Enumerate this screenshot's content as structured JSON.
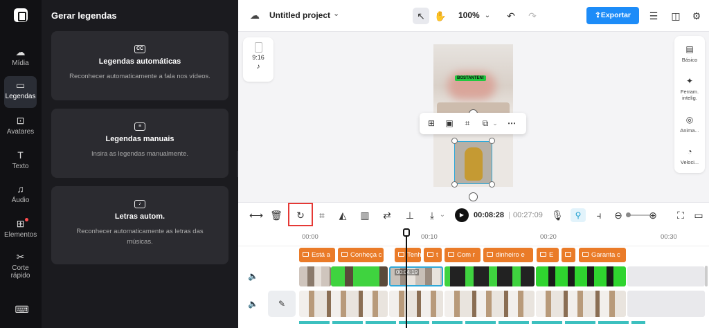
{
  "rail": {
    "items": [
      {
        "label": "Mídia",
        "icon": "cloud-upload-icon"
      },
      {
        "label": "Legendas",
        "icon": "captions-icon",
        "active": true
      },
      {
        "label": "Avatares",
        "icon": "avatar-icon"
      },
      {
        "label": "Texto",
        "icon": "text-icon"
      },
      {
        "label": "Áudio",
        "icon": "music-icon"
      },
      {
        "label": "Elementos",
        "icon": "elements-icon"
      },
      {
        "label": "Corte rápido",
        "icon": "quick-cut-icon"
      },
      {
        "label": "",
        "icon": "keyboard-icon"
      }
    ]
  },
  "panel": {
    "title": "Gerar legendas",
    "cards": [
      {
        "title": "Legendas automáticas",
        "desc": "Reconhecer automaticamente a fala nos vídeos.",
        "icon": "cc-icon"
      },
      {
        "title": "Legendas manuais",
        "desc": "Insira as legendas manualmente.",
        "icon": "subtitle-icon"
      },
      {
        "title": "Letras autom.",
        "desc": "Reconhecer automaticamente as letras das músicas.",
        "icon": "lyrics-icon"
      }
    ]
  },
  "topbar": {
    "project_name": "Untitled project",
    "zoom": "100%",
    "export_label": "Exportar"
  },
  "canvas": {
    "aspect_ratio": "9:16",
    "preview_caption": "BOSTANTEN!"
  },
  "right_tools": [
    {
      "label": "Básico",
      "icon": "film-icon"
    },
    {
      "label": "Ferram. intelig.",
      "icon": "magic-wand-icon"
    },
    {
      "label": "Anima...",
      "icon": "animation-icon"
    },
    {
      "label": "Veloci...",
      "icon": "speed-icon"
    }
  ],
  "player": {
    "current_time": "00:08:28",
    "separator": "|",
    "total_time": "00:27:09"
  },
  "timeline": {
    "ruler": [
      "00:00",
      "00:10",
      "00:20",
      "00:30"
    ],
    "text_clips": [
      "Está a",
      "Conheça c",
      "Tenh",
      "t",
      "Com r",
      "dinheiro e",
      "E",
      "",
      "Garanta c"
    ],
    "clip_time": "00:04:19"
  },
  "colors": {
    "accent": "#1d8cf8",
    "caption_clip": "#ea7b28",
    "selection": "#2fa8d8",
    "highlight_box": "#e53935"
  }
}
